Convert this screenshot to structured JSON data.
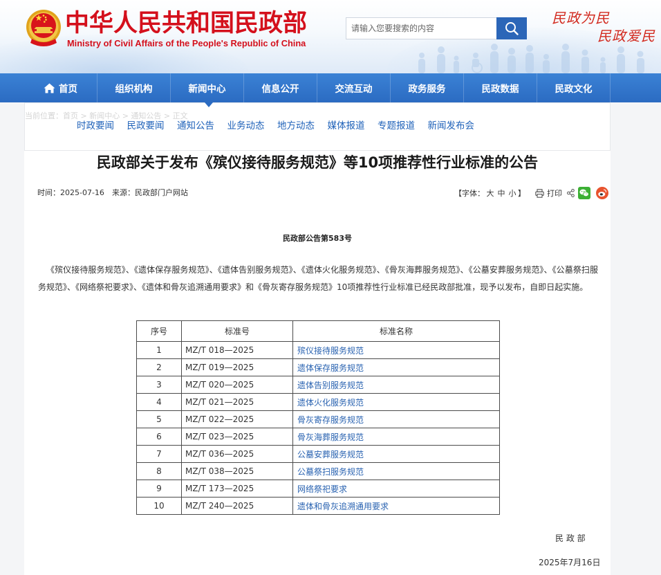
{
  "header": {
    "title": "中华人民共和国民政部",
    "subtitle": "Ministry of Civil Affairs of the People's Republic of China",
    "slogan_1": "民政为民",
    "slogan_2": "民政爱民",
    "search": {
      "placeholder": "请输入您要搜索的内容"
    }
  },
  "nav": {
    "items": [
      {
        "label": "首页"
      },
      {
        "label": "组织机构"
      },
      {
        "label": "新闻中心"
      },
      {
        "label": "信息公开"
      },
      {
        "label": "交流互动"
      },
      {
        "label": "政务服务"
      },
      {
        "label": "民政数据"
      },
      {
        "label": "民政文化"
      }
    ],
    "active": "新闻中心"
  },
  "breadcrumb": "当前位置：首页 > 新闻中心 > 通知公告 > 正文",
  "subnav": {
    "items": [
      "时政要闻",
      "民政要闻",
      "通知公告",
      "业务动态",
      "地方动态",
      "媒体报道",
      "专题报道",
      "新闻发布会"
    ]
  },
  "article": {
    "title": "民政部关于发布《殡仪接待服务规范》等10项推荐性行业标准的公告",
    "time": "时间：2025-07-16",
    "source": "来源：民政部门户网站",
    "font_size": {
      "prefix": "【字体：",
      "options": [
        "大",
        "中",
        "小"
      ],
      "suffix": "】"
    },
    "print_label": "打印",
    "notice_number": "民政部公告第583号",
    "body": "《殡仪接待服务规范》、《遗体保存服务规范》、《遗体告别服务规范》、《遗体火化服务规范》、《骨灰海葬服务规范》、《公墓安葬服务规范》、《公墓祭扫服务规范》、《网络祭祀要求》、《遗体和骨灰追溯通用要求》和《骨灰寄存服务规范》10项推荐性行业标准已经民政部批准，现予以发布，自即日起实施。",
    "table": {
      "headers": [
        "序号",
        "标准号",
        "标准名称"
      ],
      "rows": [
        {
          "no": "1",
          "code": "MZ/T 018—2025",
          "name": "殡仪接待服务规范"
        },
        {
          "no": "2",
          "code": "MZ/T 019—2025",
          "name": "遗体保存服务规范"
        },
        {
          "no": "3",
          "code": "MZ/T 020—2025",
          "name": "遗体告别服务规范"
        },
        {
          "no": "4",
          "code": "MZ/T 021—2025",
          "name": "遗体火化服务规范"
        },
        {
          "no": "5",
          "code": "MZ/T 022—2025",
          "name": "骨灰寄存服务规范"
        },
        {
          "no": "6",
          "code": "MZ/T 023—2025",
          "name": "骨灰海葬服务规范"
        },
        {
          "no": "7",
          "code": "MZ/T 036—2025",
          "name": "公墓安葬服务规范"
        },
        {
          "no": "8",
          "code": "MZ/T 038—2025",
          "name": "公墓祭扫服务规范"
        },
        {
          "no": "9",
          "code": "MZ/T 173—2025",
          "name": "网络祭祀要求"
        },
        {
          "no": "10",
          "code": "MZ/T 240—2025",
          "name": "遗体和骨灰追溯通用要求"
        }
      ]
    },
    "signature": "民 政 部",
    "date": "2025年7月16日"
  },
  "icons": {
    "emblem": "national-emblem-icon",
    "search": "search-icon",
    "home": "home-icon",
    "print": "print-icon",
    "share": "share-icon",
    "wechat": "wechat-icon",
    "weibo": "weibo-icon"
  },
  "colors": {
    "brand_red": "#d4101c",
    "nav_blue": "#2b6bc2",
    "subnav_blue": "#1f62b9",
    "link_blue": "#2a63b1",
    "search_button": "#2b66b8"
  }
}
